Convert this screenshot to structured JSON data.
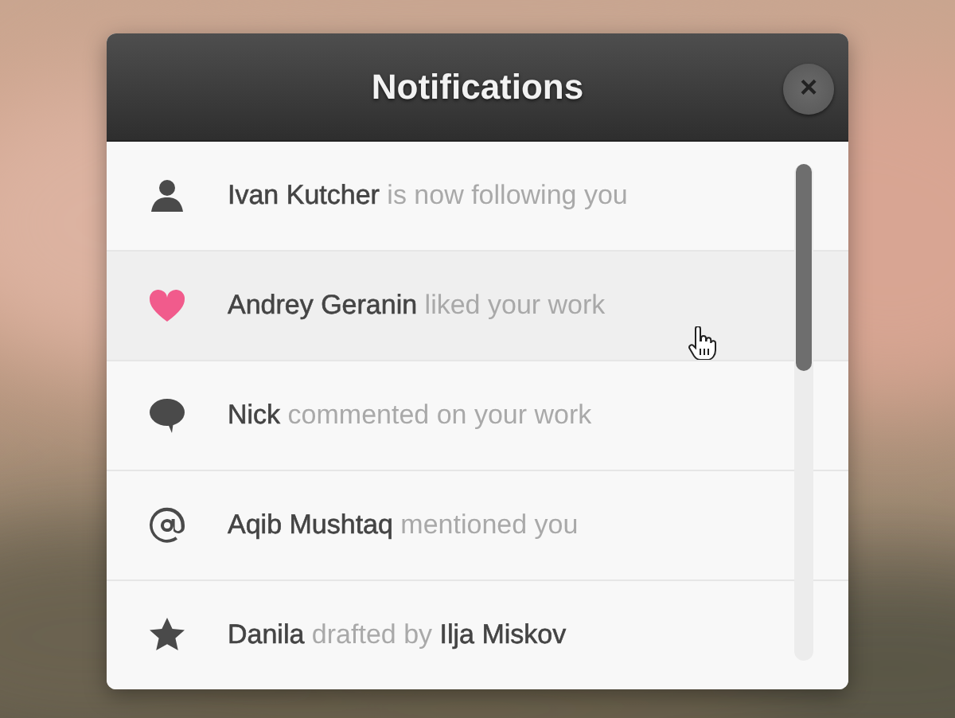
{
  "panel": {
    "title": "Notifications",
    "close_label": "×"
  },
  "notifications": [
    {
      "kind": "follow",
      "text": "**Ivan Kutcher** is now following you",
      "hovered": false
    },
    {
      "kind": "like",
      "text": "**Andrey Geranin** liked your work",
      "hovered": true
    },
    {
      "kind": "comment",
      "text": "**Nick** commented on your work",
      "hovered": false
    },
    {
      "kind": "mention",
      "text": "**Aqib Mushtaq** mentioned you",
      "hovered": false
    },
    {
      "kind": "draft",
      "text": "**Danila** drafted by **Ilja Miskov**",
      "hovered": false
    }
  ]
}
